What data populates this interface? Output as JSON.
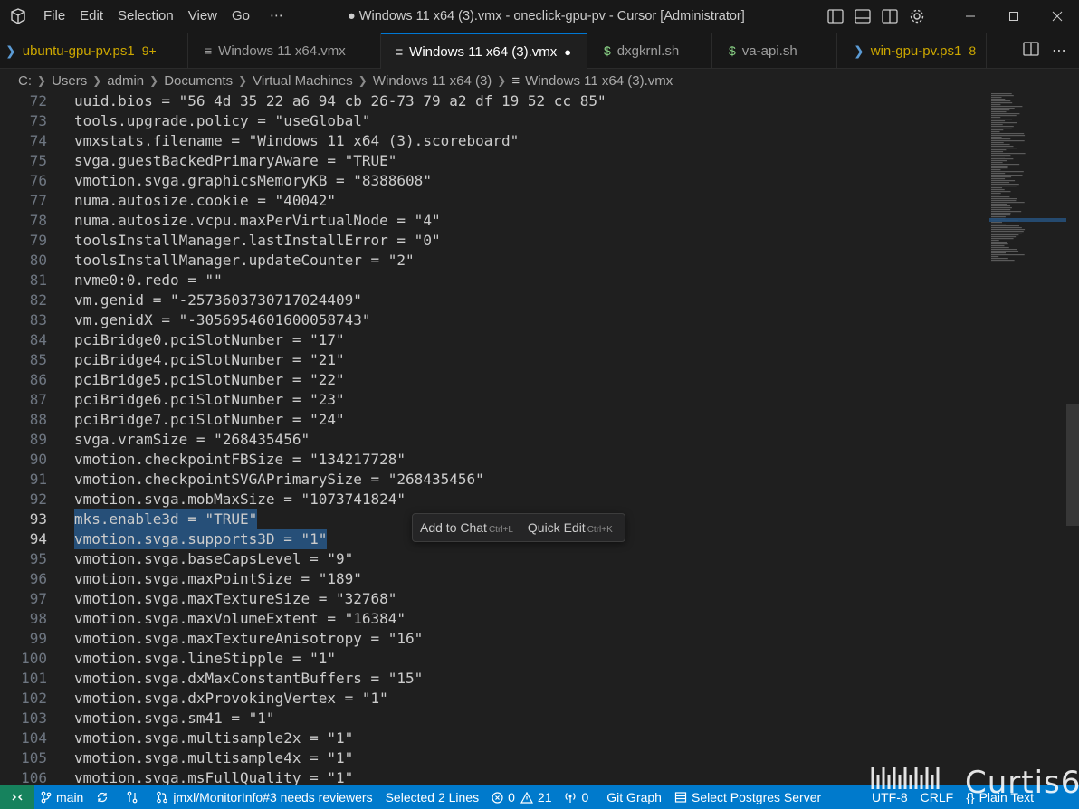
{
  "titlebar": {
    "menu": [
      "File",
      "Edit",
      "Selection",
      "View",
      "Go",
      "⋯"
    ],
    "title": "● Windows 11 x64 (3).vmx - oneclick-gpu-pv - Cursor [Administrator]"
  },
  "tabs": [
    {
      "label": "ubuntu-gpu-pv.ps1",
      "badge": "9+",
      "icon": "powershell-icon",
      "color": "#cca700"
    },
    {
      "label": "Windows 11 x64.vmx",
      "badge": "",
      "icon": "file-lines-icon",
      "color": "#9d9d9d"
    },
    {
      "label": "Windows 11 x64 (3).vmx",
      "badge": "●",
      "icon": "file-lines-icon",
      "color": "#ffffff"
    },
    {
      "label": "dxgkrnl.sh",
      "badge": "",
      "icon": "dollar-icon",
      "color": "#9d9d9d"
    },
    {
      "label": "va-api.sh",
      "badge": "",
      "icon": "dollar-icon",
      "color": "#9d9d9d"
    },
    {
      "label": "win-gpu-pv.ps1",
      "badge": "8",
      "icon": "powershell-icon",
      "color": "#cca700"
    }
  ],
  "breadcrumb": [
    "C:",
    "Users",
    "admin",
    "Documents",
    "Virtual Machines",
    "Windows 11 x64 (3)",
    "Windows 11 x64 (3).vmx"
  ],
  "editor": {
    "lines": [
      {
        "n": "72",
        "text": "uuid.bios = \"56 4d 35 22 a6 94 cb 26-73 79 a2 df 19 52 cc 85\""
      },
      {
        "n": "73",
        "text": "tools.upgrade.policy = \"useGlobal\""
      },
      {
        "n": "74",
        "text": "vmxstats.filename = \"Windows 11 x64 (3).scoreboard\""
      },
      {
        "n": "75",
        "text": "svga.guestBackedPrimaryAware = \"TRUE\""
      },
      {
        "n": "76",
        "text": "vmotion.svga.graphicsMemoryKB = \"8388608\""
      },
      {
        "n": "77",
        "text": "numa.autosize.cookie = \"40042\""
      },
      {
        "n": "78",
        "text": "numa.autosize.vcpu.maxPerVirtualNode = \"4\""
      },
      {
        "n": "79",
        "text": "toolsInstallManager.lastInstallError = \"0\""
      },
      {
        "n": "80",
        "text": "toolsInstallManager.updateCounter = \"2\""
      },
      {
        "n": "81",
        "text": "nvme0:0.redo = \"\""
      },
      {
        "n": "82",
        "text": "vm.genid = \"-2573603730717024409\""
      },
      {
        "n": "83",
        "text": "vm.genidX = \"-3056954601600058743\""
      },
      {
        "n": "84",
        "text": "pciBridge0.pciSlotNumber = \"17\""
      },
      {
        "n": "85",
        "text": "pciBridge4.pciSlotNumber = \"21\""
      },
      {
        "n": "86",
        "text": "pciBridge5.pciSlotNumber = \"22\""
      },
      {
        "n": "87",
        "text": "pciBridge6.pciSlotNumber = \"23\""
      },
      {
        "n": "88",
        "text": "pciBridge7.pciSlotNumber = \"24\""
      },
      {
        "n": "89",
        "text": "svga.vramSize = \"268435456\""
      },
      {
        "n": "90",
        "text": "vmotion.checkpointFBSize = \"134217728\""
      },
      {
        "n": "91",
        "text": "vmotion.checkpointSVGAPrimarySize = \"268435456\""
      },
      {
        "n": "92",
        "text": "vmotion.svga.mobMaxSize = \"1073741824\""
      },
      {
        "n": "93",
        "text": "mks.enable3d = \"TRUE\"",
        "selected": true
      },
      {
        "n": "94",
        "text": "vmotion.svga.supports3D = \"1\"",
        "selected": true
      },
      {
        "n": "95",
        "text": "vmotion.svga.baseCapsLevel = \"9\""
      },
      {
        "n": "96",
        "text": "vmotion.svga.maxPointSize = \"189\""
      },
      {
        "n": "97",
        "text": "vmotion.svga.maxTextureSize = \"32768\""
      },
      {
        "n": "98",
        "text": "vmotion.svga.maxVolumeExtent = \"16384\""
      },
      {
        "n": "99",
        "text": "vmotion.svga.maxTextureAnisotropy = \"16\""
      },
      {
        "n": "100",
        "text": "vmotion.svga.lineStipple = \"1\""
      },
      {
        "n": "101",
        "text": "vmotion.svga.dxMaxConstantBuffers = \"15\""
      },
      {
        "n": "102",
        "text": "vmotion.svga.dxProvokingVertex = \"1\""
      },
      {
        "n": "103",
        "text": "vmotion.svga.sm41 = \"1\""
      },
      {
        "n": "104",
        "text": "vmotion.svga.multisample2x = \"1\""
      },
      {
        "n": "105",
        "text": "vmotion.svga.multisample4x = \"1\""
      },
      {
        "n": "106",
        "text": "vmotion.svga.msFullQuality = \"1\""
      }
    ],
    "floating_actions": {
      "add_to_chat": "Add to Chat",
      "add_to_chat_key": "Ctrl+L",
      "quick_edit": "Quick Edit",
      "quick_edit_key": "Ctrl+K"
    }
  },
  "statusbar": {
    "branch": "main",
    "pr": "jmxl/MonitorInfo#3 needs reviewers",
    "selection": "Selected 2 Lines",
    "errors": "0",
    "warnings": "21",
    "ports": "0",
    "git_graph": "Git Graph",
    "postgres": "Select Postgres Server",
    "encoding": "UTF-8",
    "eol": "CRLF",
    "language": "Plain Text"
  },
  "watermark": "Curtis6",
  "colors": {
    "accent": "#0078d4",
    "statusbar": "#007acc",
    "remote": "#16825d",
    "selection": "#264f78",
    "warning_tab": "#cca700"
  }
}
